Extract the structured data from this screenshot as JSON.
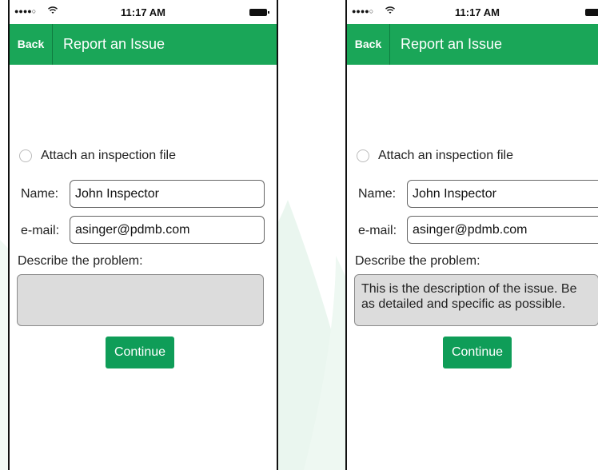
{
  "screens": [
    {
      "status": {
        "signal": "●●●●○",
        "time": "11:17 AM"
      },
      "nav": {
        "back_label": "Back",
        "title": "Report an Issue"
      },
      "attach_label": "Attach an inspection file",
      "name_label": "Name:",
      "name_value": "John Inspector",
      "email_label": "e-mail:",
      "email_value": "asinger@pdmb.com",
      "describe_label": "Describe the problem:",
      "description_value": "",
      "continue_label": "Continue"
    },
    {
      "status": {
        "signal": "●●●●○",
        "time": "11:17 AM"
      },
      "nav": {
        "back_label": "Back",
        "title": "Report an Issue"
      },
      "attach_label": "Attach an inspection file",
      "name_label": "Name:",
      "name_value": "John Inspector",
      "email_label": "e-mail:",
      "email_value": "asinger@pdmb.com",
      "describe_label": "Describe the problem:",
      "description_value": " This is the description of the issue. Be as detailed and specific as possible.",
      "continue_label": "Continue"
    }
  ],
  "colors": {
    "nav_green": "#1aa658",
    "button_green": "#0f9d58",
    "textarea_gray": "#dcdcdc"
  },
  "icons": {
    "wifi": "wifi-icon",
    "battery": "battery-icon"
  }
}
